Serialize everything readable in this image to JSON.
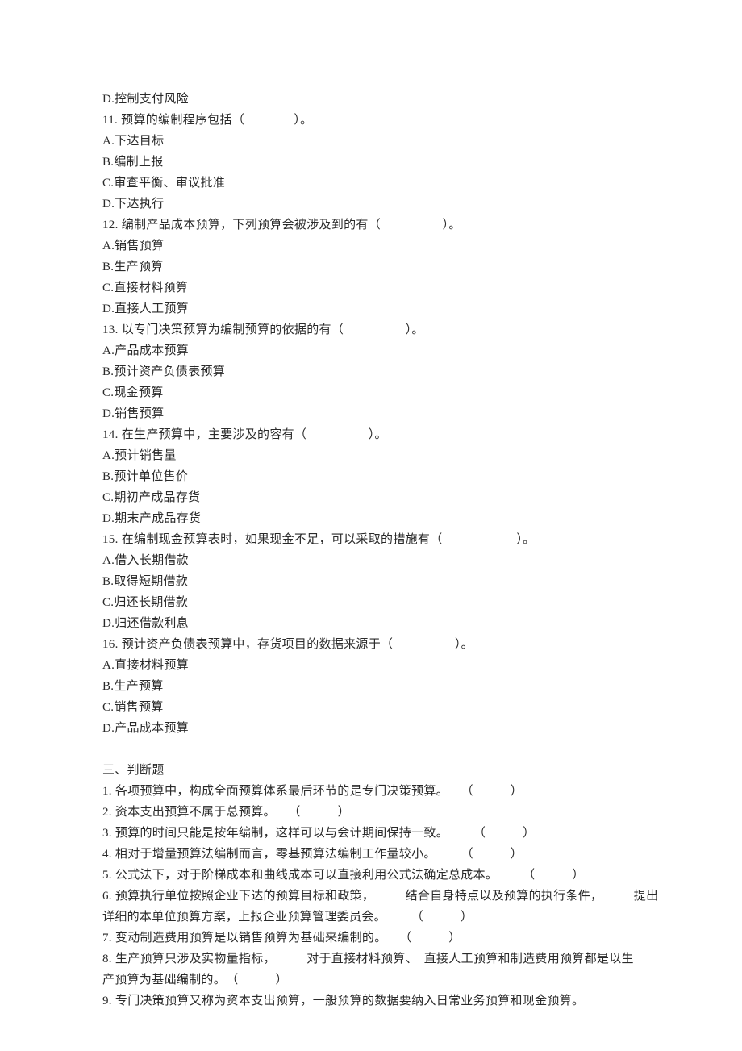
{
  "top_option": "D.控制支付风险",
  "questions": [
    {
      "num": "11.",
      "stem": "预算的编制程序包括（　　　　）。",
      "options": [
        "A.下达目标",
        "B.编制上报",
        "C.审查平衡、审议批准",
        "D.下达执行"
      ]
    },
    {
      "num": "12.",
      "stem": "编制产品成本预算，下列预算会被涉及到的有（　　　　　）。",
      "options": [
        "A.销售预算",
        "B.生产预算",
        "C.直接材料预算",
        "D.直接人工预算"
      ]
    },
    {
      "num": "13.",
      "stem": "以专门决策预算为编制预算的依据的有（　　　　　）。",
      "options": [
        "A.产品成本预算",
        "B.预计资产负债表预算",
        "C.现金预算",
        "D.销售预算"
      ]
    },
    {
      "num": "14.",
      "stem": "在生产预算中，主要涉及的容有（　　　　　）。",
      "options": [
        "A.预计销售量",
        "B.预计单位售价",
        "C.期初产成品存货",
        "D.期末产成品存货"
      ]
    },
    {
      "num": "15.",
      "stem": "在编制现金预算表时，如果现金不足，可以采取的措施有（　　　　　　）。",
      "options": [
        "A.借入长期借款",
        "B.取得短期借款",
        "C.归还长期借款",
        "D.归还借款利息"
      ]
    },
    {
      "num": "16.",
      "stem": "预计资产负债表预算中，存货项目的数据来源于（　　　　　）。",
      "options": [
        "A.直接材料预算",
        "B.生产预算",
        "C.销售预算",
        "D.产品成本预算"
      ]
    }
  ],
  "section_header": "三、判断题",
  "judgments": [
    "1. 各项预算中，构成全面预算体系最后环节的是专门决策预算。　　（　　　）",
    "2. 资本支出预算不属于总预算。　　（　　　）",
    "3. 预算的时间只能是按年编制，这样可以与会计期间保持一致。　　　（　　　）",
    "4. 相对于增量预算法编制而言，零基预算法编制工作量较小。　　　（　　　）",
    "5. 公式法下，对于阶梯成本和曲线成本可以直接利用公式法确定总成本。　　　（　　　）",
    "6. 预算执行单位按照企业下达的预算目标和政策，　　　结合自身特点以及预算的执行条件，　　　提出",
    "详细的本单位预算方案，上报企业预算管理委员会。　　　（　　　）",
    "7. 变动制造费用预算是以销售预算为基础来编制的。　　（　　　）",
    "8. 生产预算只涉及实物量指标，　　　对于直接材料预算、　直接人工预算和制造费用预算都是以生",
    "产预算为基础编制的。　（　　　）",
    "9. 专门决策预算又称为资本支出预算，一般预算的数据要纳入日常业务预算和现金预算。"
  ]
}
